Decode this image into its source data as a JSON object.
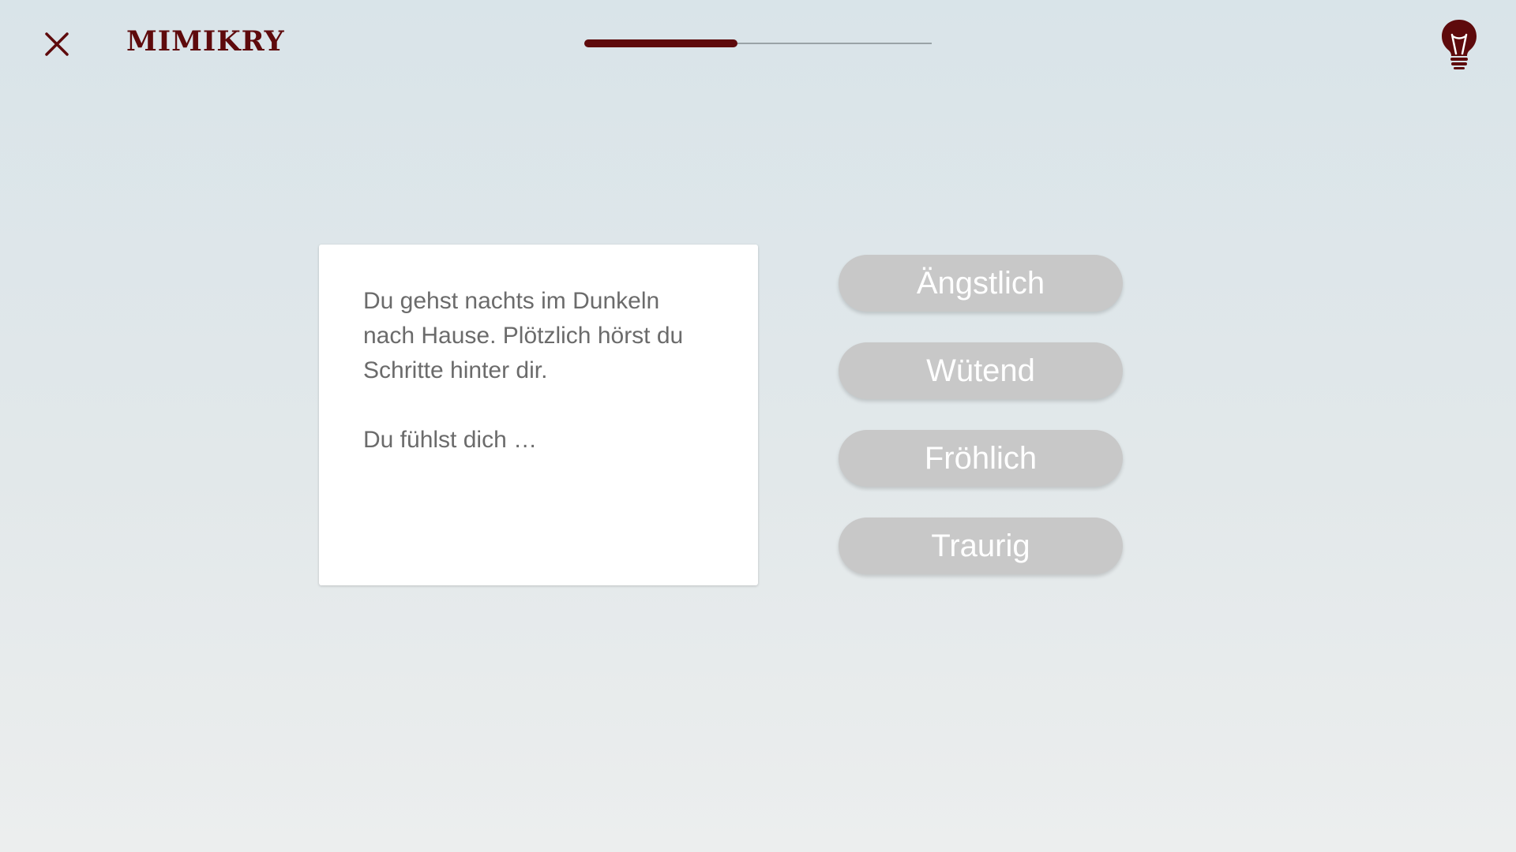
{
  "header": {
    "title": "MIMIKRY",
    "close_icon": "close-icon",
    "hint_icon": "lightbulb-icon",
    "progress": 0.44
  },
  "question": {
    "text": "Du gehst nachts im Dunkeln nach Hause. Plötzlich hörst du Schritte hinter dir.",
    "prompt": "Du fühlst dich …"
  },
  "answers": [
    {
      "label": "Ängstlich"
    },
    {
      "label": "Wütend"
    },
    {
      "label": "Fröhlich"
    },
    {
      "label": "Traurig"
    }
  ],
  "colors": {
    "brand": "#5e0a0c",
    "answer_button": "#c8c8c8",
    "card": "#ffffff",
    "text": "#6b6b6b"
  }
}
